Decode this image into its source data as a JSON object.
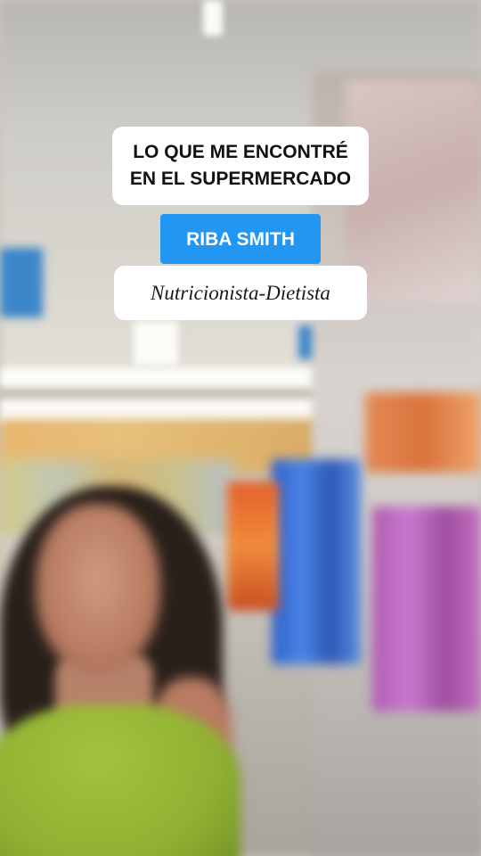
{
  "overlay": {
    "headline_lines": [
      "LO QUE ME ENCONTRÉ",
      "EN EL SUPERMERCADO"
    ],
    "brand": "RIBA SMITH",
    "subtitle": "Nutricionista-Dietista"
  },
  "colors": {
    "brand_bg": "#2196f3",
    "caption_bg": "#ffffff",
    "shirt": "#9ab836"
  }
}
